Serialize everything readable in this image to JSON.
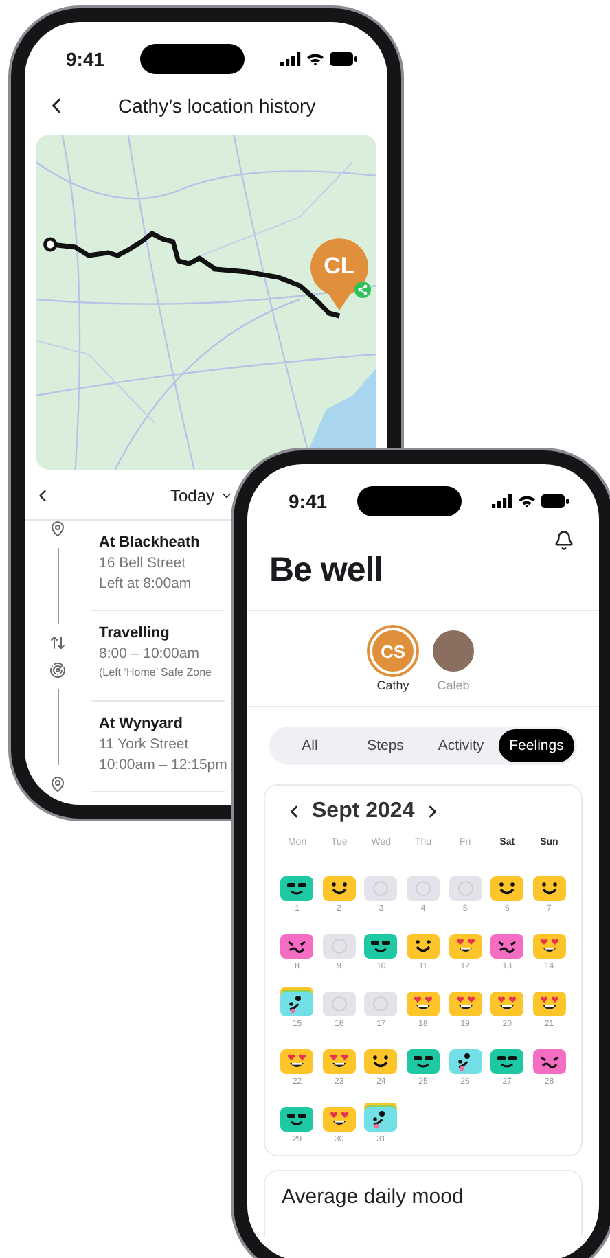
{
  "location_screen": {
    "status_time": "9:41",
    "title": "Cathy’s location history",
    "map": {
      "marker": "CL"
    },
    "date_filter": "Today",
    "entries": [
      {
        "kind": "stop",
        "title": "At Blackheath",
        "lines": [
          "16 Bell Street",
          "Left at 8:00am"
        ]
      },
      {
        "kind": "travel",
        "title": "Travelling",
        "lines": [
          "8:00 – 10:00am"
        ],
        "note": "(Left ‘Home’ Safe Zone"
      },
      {
        "kind": "stop",
        "title": "At Wynyard",
        "lines": [
          "11 York Street",
          "10:00am – 12:15pm"
        ]
      }
    ]
  },
  "wellbeing_screen": {
    "status_time": "9:41",
    "title": "Be well",
    "people": [
      {
        "kind": "initials",
        "initials": "CS",
        "name": "Cathy",
        "selected": true
      },
      {
        "kind": "photo",
        "name": "Caleb",
        "selected": false
      }
    ],
    "tabs": [
      {
        "label": "All",
        "selected": false
      },
      {
        "label": "Steps",
        "selected": false
      },
      {
        "label": "Activity",
        "selected": false
      },
      {
        "label": "Feelings",
        "selected": true
      }
    ],
    "calendar": {
      "month": "Sept 2024",
      "weekdays": [
        {
          "label": "Mon",
          "weekend": false
        },
        {
          "label": "Tue",
          "weekend": false
        },
        {
          "label": "Wed",
          "weekend": false
        },
        {
          "label": "Thu",
          "weekend": false
        },
        {
          "label": "Fri",
          "weekend": false
        },
        {
          "label": "Sat",
          "weekend": true
        },
        {
          "label": "Sun",
          "weekend": true
        }
      ],
      "days": [
        {
          "day": "1",
          "kind": "cool",
          "stacked": false
        },
        {
          "day": "2",
          "kind": "happy",
          "stacked": false
        },
        {
          "day": "3",
          "kind": "none",
          "stacked": false
        },
        {
          "day": "4",
          "kind": "none",
          "stacked": false
        },
        {
          "day": "5",
          "kind": "none",
          "stacked": false
        },
        {
          "day": "6",
          "kind": "happy",
          "stacked": false
        },
        {
          "day": "7",
          "kind": "happy",
          "stacked": false
        },
        {
          "day": "8",
          "kind": "silly",
          "stacked": false
        },
        {
          "day": "9",
          "kind": "none",
          "stacked": false
        },
        {
          "day": "10",
          "kind": "cool",
          "stacked": false
        },
        {
          "day": "11",
          "kind": "happy",
          "stacked": false
        },
        {
          "day": "12",
          "kind": "love",
          "stacked": false
        },
        {
          "day": "13",
          "kind": "silly",
          "stacked": false
        },
        {
          "day": "14",
          "kind": "love",
          "stacked": false
        },
        {
          "day": "15",
          "kind": "wink",
          "stacked": true
        },
        {
          "day": "16",
          "kind": "none",
          "stacked": false
        },
        {
          "day": "17",
          "kind": "none",
          "stacked": false
        },
        {
          "day": "18",
          "kind": "love",
          "stacked": false
        },
        {
          "day": "19",
          "kind": "love",
          "stacked": false
        },
        {
          "day": "20",
          "kind": "love",
          "stacked": false
        },
        {
          "day": "21",
          "kind": "love",
          "stacked": false
        },
        {
          "day": "22",
          "kind": "love",
          "stacked": false
        },
        {
          "day": "23",
          "kind": "love",
          "stacked": false
        },
        {
          "day": "24",
          "kind": "happy",
          "stacked": false
        },
        {
          "day": "25",
          "kind": "cool",
          "stacked": false
        },
        {
          "day": "26",
          "kind": "wink",
          "stacked": false
        },
        {
          "day": "27",
          "kind": "cool",
          "stacked": false
        },
        {
          "day": "28",
          "kind": "silly",
          "stacked": false
        },
        {
          "day": "29",
          "kind": "cool",
          "stacked": false
        },
        {
          "day": "30",
          "kind": "love",
          "stacked": false
        },
        {
          "day": "31",
          "kind": "wink",
          "stacked": true
        }
      ]
    },
    "summary_title": "Average daily mood"
  }
}
